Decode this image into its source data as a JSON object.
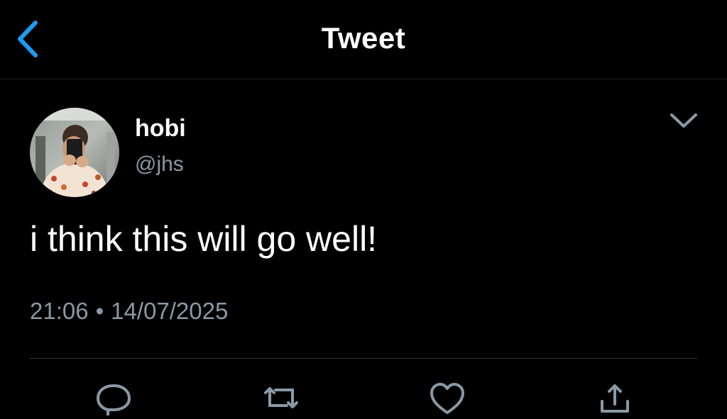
{
  "header": {
    "title": "Tweet",
    "back_icon": "chevron-left-icon",
    "accent_color": "#1d9bf0"
  },
  "tweet": {
    "author": {
      "display_name": "hobi",
      "handle": "@jhs"
    },
    "text": "i think this will go well!",
    "time": "21:06",
    "separator": "•",
    "date": "14/07/2025",
    "menu_icon": "chevron-down-icon"
  },
  "actions": {
    "icons": [
      "reply-icon",
      "retweet-icon",
      "like-icon",
      "share-icon"
    ]
  },
  "colors": {
    "background": "#000000",
    "text": "#ffffff",
    "secondary_text": "#8b98a5",
    "divider": "#2f3336"
  }
}
